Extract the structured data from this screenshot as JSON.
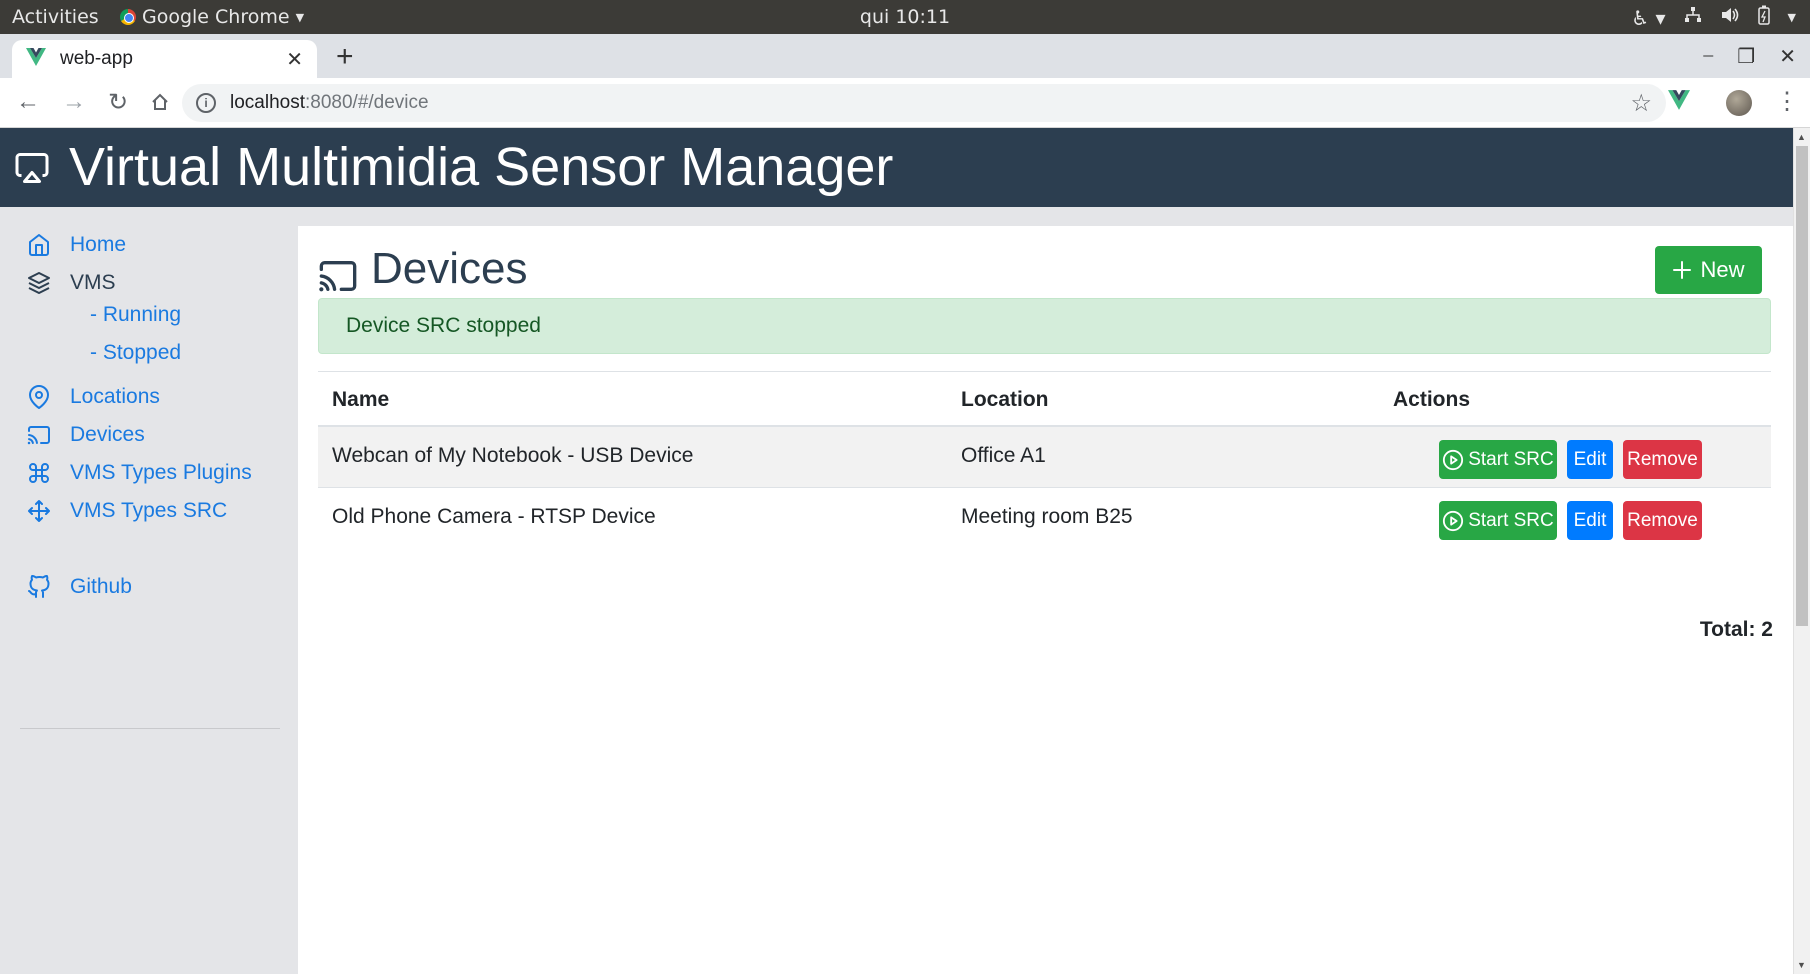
{
  "os": {
    "activities": "Activities",
    "app_name": "Google Chrome",
    "clock": "qui 10:11"
  },
  "browser": {
    "tab_title": "web-app",
    "url_host": "localhost",
    "url_rest": ":8080/#/device"
  },
  "app": {
    "title": "Virtual Multimidia Sensor Manager"
  },
  "sidebar": {
    "home": "Home",
    "vms": "VMS",
    "running": "- Running",
    "stopped": "- Stopped",
    "locations": "Locations",
    "devices": "Devices",
    "vms_types_plugins": "VMS Types Plugins",
    "vms_types_src": "VMS Types SRC",
    "github": "Github"
  },
  "main": {
    "heading": "Devices",
    "new_button": "New",
    "alert": "Device SRC stopped",
    "columns": {
      "name": "Name",
      "location": "Location",
      "actions": "Actions"
    },
    "rows": [
      {
        "name": "Webcan of My Notebook - USB Device",
        "location": "Office A1",
        "start": "Start SRC",
        "edit": "Edit",
        "remove": "Remove"
      },
      {
        "name": "Old Phone Camera - RTSP Device",
        "location": "Meeting room B25",
        "start": "Start SRC",
        "edit": "Edit",
        "remove": "Remove"
      }
    ],
    "total": "Total: 2"
  },
  "colors": {
    "header_bg": "#2c3e50",
    "link": "#1a7ae0",
    "success": "#28a745",
    "primary": "#007bff",
    "danger": "#dc3545",
    "alert_bg": "#d4edda"
  }
}
